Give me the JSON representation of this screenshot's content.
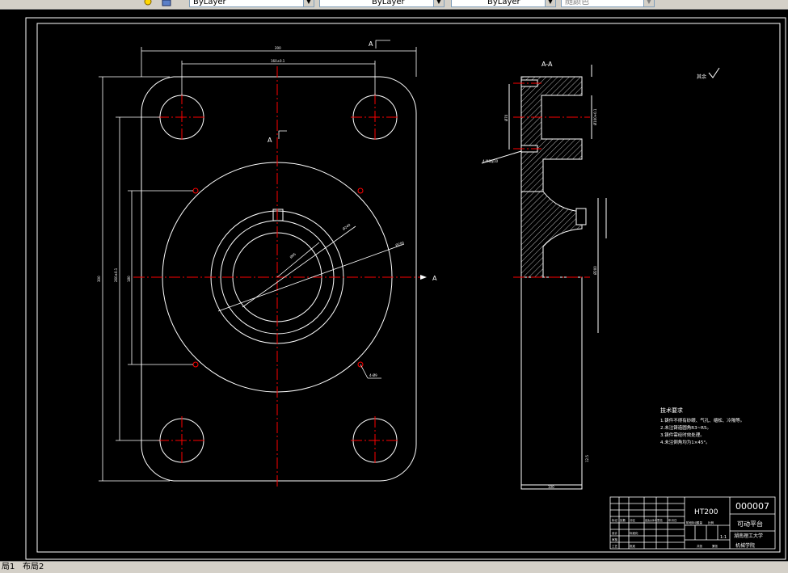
{
  "toolbar": {
    "layer_combo": "ByLayer",
    "linetype_combo": "ByLayer",
    "lineweight_combo": "ByLayer",
    "plotstyle_combo": "随颜色"
  },
  "layout_tabs": [
    "局1",
    "布局2"
  ],
  "drawing": {
    "section_label_top": "A",
    "section_label_mid": "A",
    "section_label_right": "A",
    "section_view_title": "A-A",
    "dim_top_outer": "200",
    "dim_top_inner": "160±0.1",
    "dim_left_outer": "300",
    "dim_left_inner": "260±0.1",
    "dim_left_mid": "180",
    "dim_r_large": "Ø200",
    "dim_r_outer": "Ø240",
    "dim_r_inner": "Ø95",
    "dim_hole": "4-Ø9",
    "roughness_note": "其余",
    "sec_dim_1": "Ø70",
    "sec_dim_2": "Ø100+0.1",
    "sec_dim_3": "Ø200",
    "sec_dim_4": "4-M8深10",
    "sec_dim_bottom": "100",
    "sec_dim_side": "12.5"
  },
  "tech_requirements": {
    "title": "技术要求",
    "items": [
      "1.铸件不得有砂眼、气孔、缩松、冷隔等。",
      "2.未注铸造圆角R3~R5。",
      "3.铸件需经时效处理。",
      "4.未注倒角均为1×45°。"
    ]
  },
  "title_block": {
    "drawing_number": "000007",
    "material": "HT200",
    "part_name": "可动平台",
    "school": "湖南理工大学",
    "major": "机械学院",
    "scale": "1:1",
    "labels": [
      "标记",
      "处数",
      "分区",
      "更改文件号",
      "签名",
      "年月日",
      "设计",
      "标准化",
      "审核",
      "工艺",
      "批准",
      "阶段标记",
      "重量",
      "比例",
      "共张",
      "第张"
    ]
  },
  "colors": {
    "background": "#000000",
    "lines": "#ffffff",
    "centerlines": "#ff0000",
    "hatch": "#ffffff"
  }
}
